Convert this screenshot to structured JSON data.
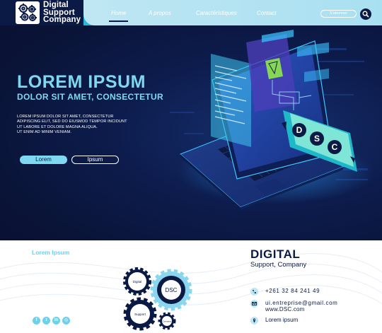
{
  "brand": {
    "line1": "Digital",
    "line2": "Support",
    "line3": "Company"
  },
  "nav": {
    "items": [
      {
        "label": "Home"
      },
      {
        "label": "A propos"
      },
      {
        "label": "Caractéristiques"
      },
      {
        "label": "Contact"
      }
    ],
    "subscribe_label": "S'abonner"
  },
  "hero": {
    "title": "LOREM IPSUM",
    "subtitle": "DOLOR SIT AMET, CONSECTETUR",
    "body": [
      "LOREM IPSUM DOLOR SIT AMET, CONSECTETUR",
      "ADIPISCING ELIT, SED DO EIUSMOD TEMPOR INCIDUNT",
      "UT LABORE ET DOLORE MAGNA ALIQUA.",
      "UT ENIM AD MINIM VENIAM."
    ],
    "button_primary": "Lorem",
    "button_secondary": "Ipsum",
    "screen_letters": [
      "D",
      "S",
      "C"
    ]
  },
  "footer": {
    "left_title": "Lorem Ipsum",
    "social_icons": [
      {
        "icon": "facebook-icon",
        "glyph": "f"
      },
      {
        "icon": "twitter-icon",
        "glyph": "t"
      },
      {
        "icon": "linkedin-icon",
        "glyph": "in"
      },
      {
        "icon": "instagram-icon",
        "glyph": "◎"
      }
    ],
    "gears": {
      "top": "Digital",
      "center": "DSC",
      "bottom": "Support",
      "small": "Company"
    },
    "brand_title": "DIGITAL",
    "brand_subtitle": "Support, Company",
    "phone": "+261 32 84 241 49",
    "email": "ui.entreprise@gmail.com",
    "website": "www.DSC.com",
    "address": "Lorem ipsum"
  },
  "colors": {
    "navy": "#0b1a44",
    "accent": "#27b9d9",
    "light_accent": "#bfe6f3",
    "hero_text": "#7fd8f0"
  }
}
